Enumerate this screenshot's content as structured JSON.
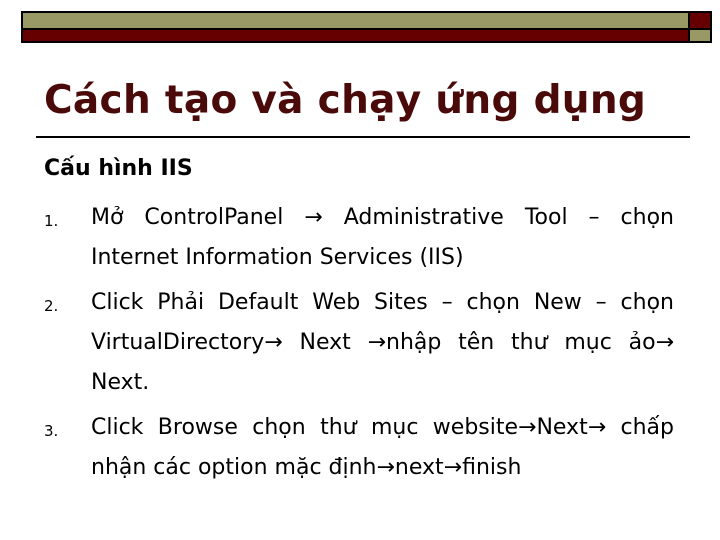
{
  "header": {
    "colors": {
      "olive": "#999966",
      "maroon": "#660000",
      "title": "#4a0a0a"
    }
  },
  "slide": {
    "title": "Cách tạo và chạy ứng dụng",
    "subheading": "Cấu hình IIS",
    "steps": [
      {
        "number": "1.",
        "text": "Mở ControlPanel → Administrative Tool – chọn Internet Information Services (IIS)"
      },
      {
        "number": "2.",
        "text": "Click Phải Default Web Sites – chọn New – chọn VirtualDirectory→ Next →nhập tên thư mục ảo→ Next."
      },
      {
        "number": "3.",
        "text": "Click Browse chọn thư mục website→Next→ chấp nhận các option mặc định→next→finish"
      }
    ]
  }
}
